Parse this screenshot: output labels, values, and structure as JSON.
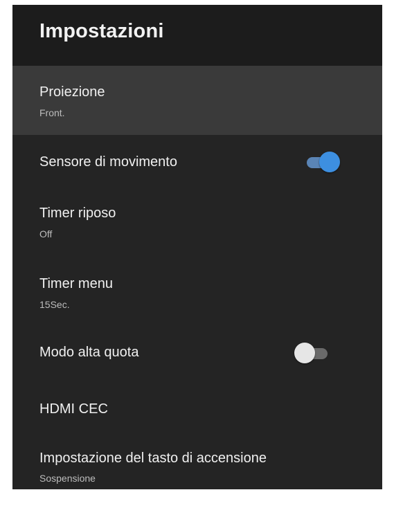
{
  "header": {
    "title": "Impostazioni"
  },
  "colors": {
    "panel_bg": "#242424",
    "header_bg": "#1c1c1c",
    "selected_bg": "#3a3a3a",
    "toggle_on": "#3d8fe0",
    "toggle_off_knob": "#e6e6e6"
  },
  "items": [
    {
      "label": "Proiezione",
      "value": "Front.",
      "selected": true
    },
    {
      "label": "Sensore di movimento",
      "toggle": "on"
    },
    {
      "label": "Timer riposo",
      "value": "Off"
    },
    {
      "label": "Timer menu",
      "value": "15Sec."
    },
    {
      "label": "Modo alta quota",
      "toggle": "off"
    },
    {
      "label": "HDMI CEC"
    },
    {
      "label": "Impostazione del tasto di accensione",
      "value": "Sospensione"
    }
  ]
}
